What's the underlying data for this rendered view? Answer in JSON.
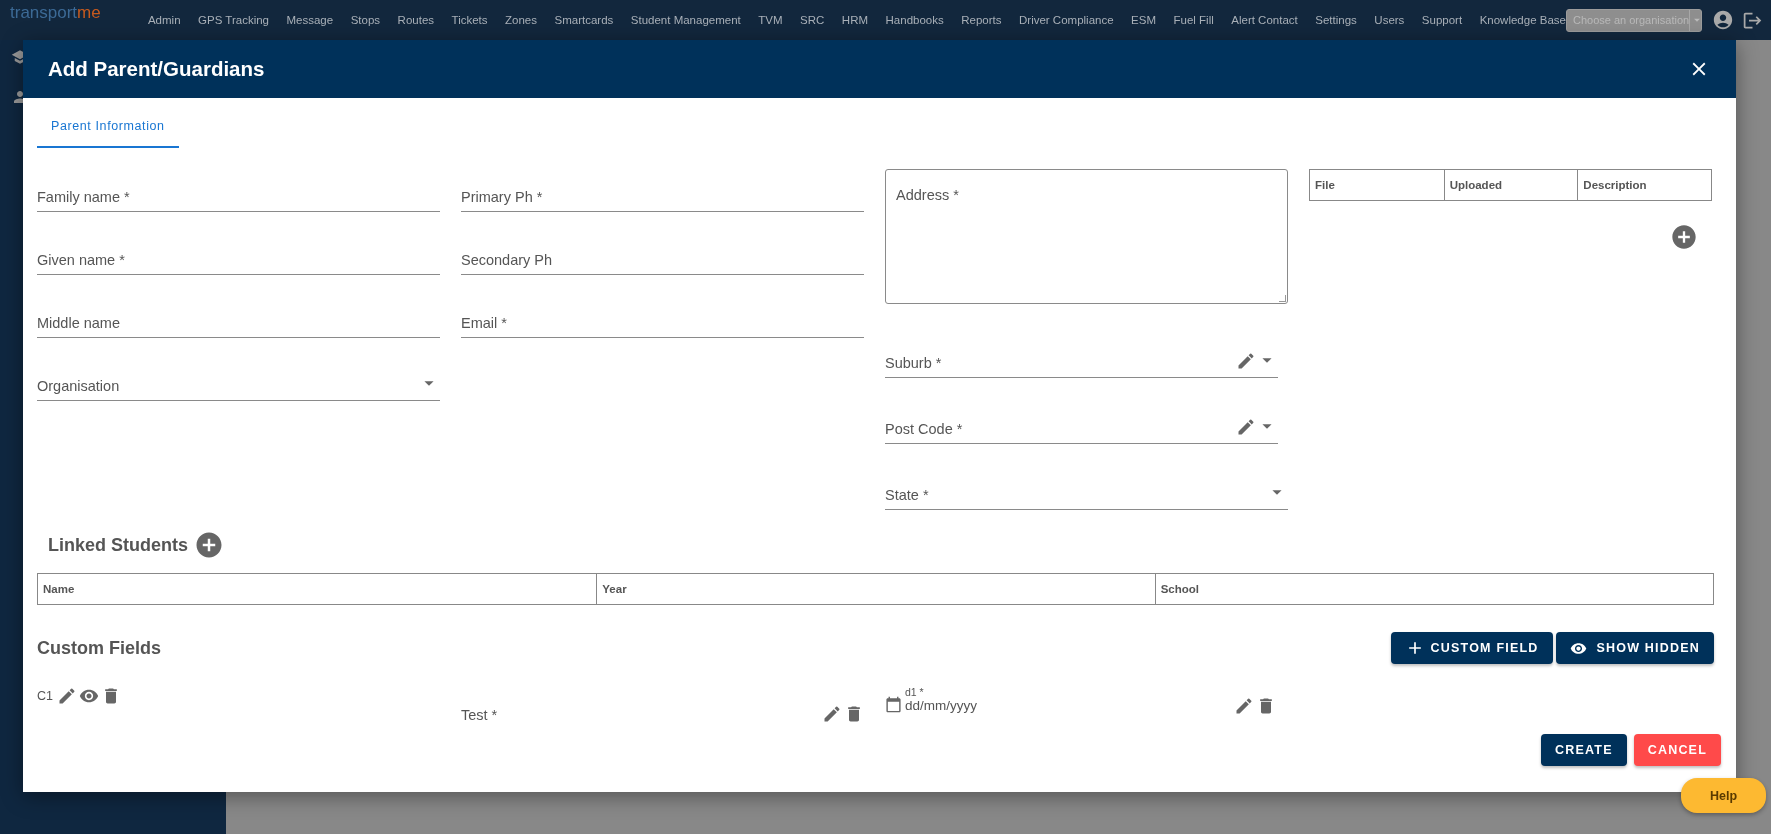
{
  "nav": {
    "brand": [
      "transport",
      "me"
    ],
    "items": [
      "Admin",
      "GPS Tracking",
      "Message",
      "Stops",
      "Routes",
      "Tickets",
      "Zones",
      "Smartcards",
      "Student Management",
      "TVM",
      "SRC",
      "HRM",
      "Handbooks",
      "Reports",
      "Driver Compliance",
      "ESM",
      "Fuel Fill",
      "Alert Contact",
      "Settings",
      "Users",
      "Support",
      "Knowledge Base"
    ],
    "org_select": {
      "placeholder": "Choose an organisation"
    }
  },
  "dialog": {
    "title": "Add Parent/Guardians",
    "tabs": [
      {
        "label": "Parent Information",
        "selected": true
      }
    ],
    "columns": [
      [
        {
          "kind": "text",
          "label": "Family name *"
        },
        {
          "kind": "text",
          "label": "Given name *"
        },
        {
          "kind": "text",
          "label": "Middle name"
        },
        {
          "kind": "select",
          "label": "Organisation"
        }
      ],
      [
        {
          "kind": "text",
          "label": "Primary Ph *"
        },
        {
          "kind": "text",
          "label": "Secondary Ph"
        },
        {
          "kind": "text",
          "label": "Email *"
        }
      ],
      [
        {
          "kind": "textarea",
          "label": "Address *"
        },
        {
          "kind": "edit-select",
          "label": "Suburb *"
        },
        {
          "kind": "edit-select",
          "label": "Post Code *"
        },
        {
          "kind": "select",
          "label": "State *"
        }
      ]
    ],
    "files_table": {
      "columns": [
        "File",
        "Uploaded",
        "Description"
      ]
    },
    "linked_students": {
      "title": "Linked Students",
      "columns": [
        "Name",
        "Year",
        "School"
      ]
    },
    "custom_fields": {
      "title": "Custom Fields",
      "buttons": [
        {
          "kind": "add",
          "label": "CUSTOM FIELD"
        },
        {
          "kind": "show",
          "label": "SHOW HIDDEN"
        }
      ],
      "items": [
        {
          "kind": "label",
          "label": "C1"
        },
        {
          "kind": "text",
          "label": "Test *"
        },
        {
          "kind": "date",
          "label": "d1 *",
          "value": "dd/mm/yyyy"
        }
      ]
    },
    "actions": [
      {
        "kind": "primary",
        "label": "CREATE"
      },
      {
        "kind": "danger",
        "label": "CANCEL"
      }
    ]
  },
  "help": {
    "label": "Help"
  }
}
